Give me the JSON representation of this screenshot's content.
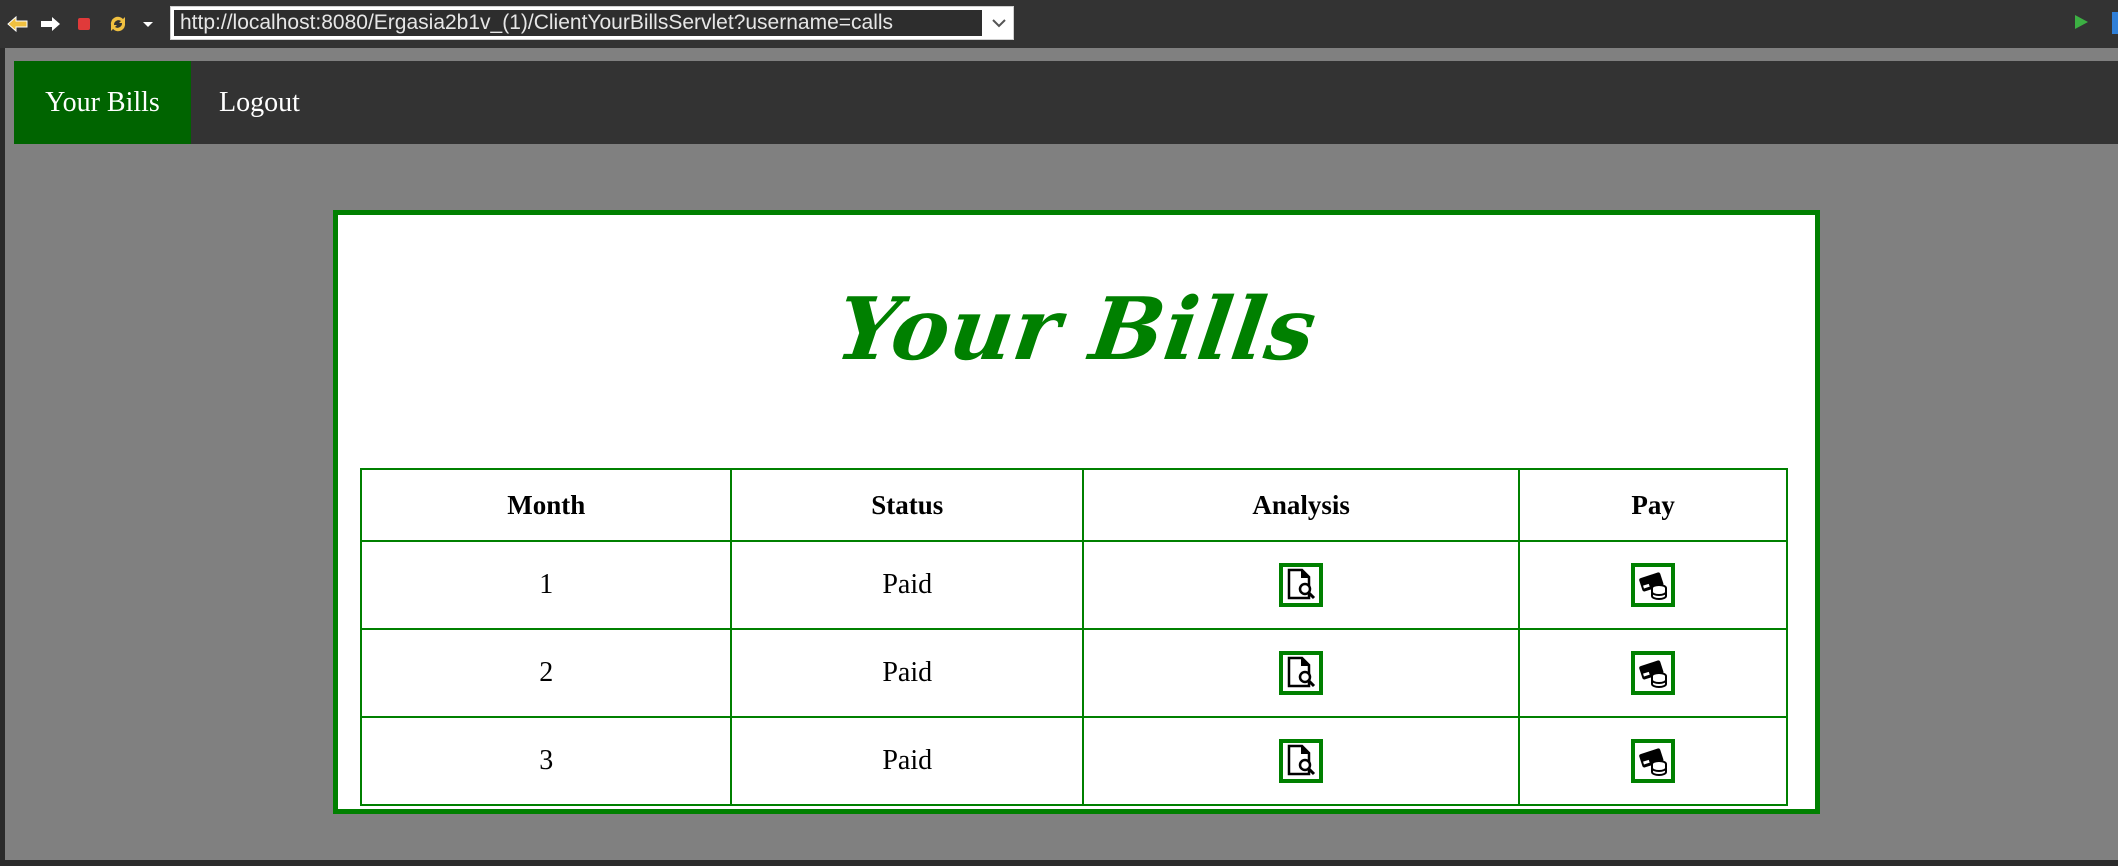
{
  "browser": {
    "url": "http://localhost:8080/Ergasia2b1v_(1)/ClientYourBillsServlet?username=calls",
    "buttons": [
      "back-icon",
      "forward-icon",
      "stop-icon",
      "refresh-icon",
      "dropdown-icon"
    ]
  },
  "nav": {
    "items": [
      {
        "label": "Your Bills",
        "active": true
      },
      {
        "label": "Logout",
        "active": false
      }
    ]
  },
  "page": {
    "title": "Your Bills",
    "accent": "#008000",
    "nav_active_bg": "#006400"
  },
  "table": {
    "headers": [
      "Month",
      "Status",
      "Analysis",
      "Pay"
    ],
    "rows": [
      {
        "month": "1",
        "status": "Paid",
        "analysis_icon": "document-search-icon",
        "pay_icon": "card-coins-icon"
      },
      {
        "month": "2",
        "status": "Paid",
        "analysis_icon": "document-search-icon",
        "pay_icon": "card-coins-icon"
      },
      {
        "month": "3",
        "status": "Paid",
        "analysis_icon": "document-search-icon",
        "pay_icon": "card-coins-icon"
      }
    ]
  }
}
